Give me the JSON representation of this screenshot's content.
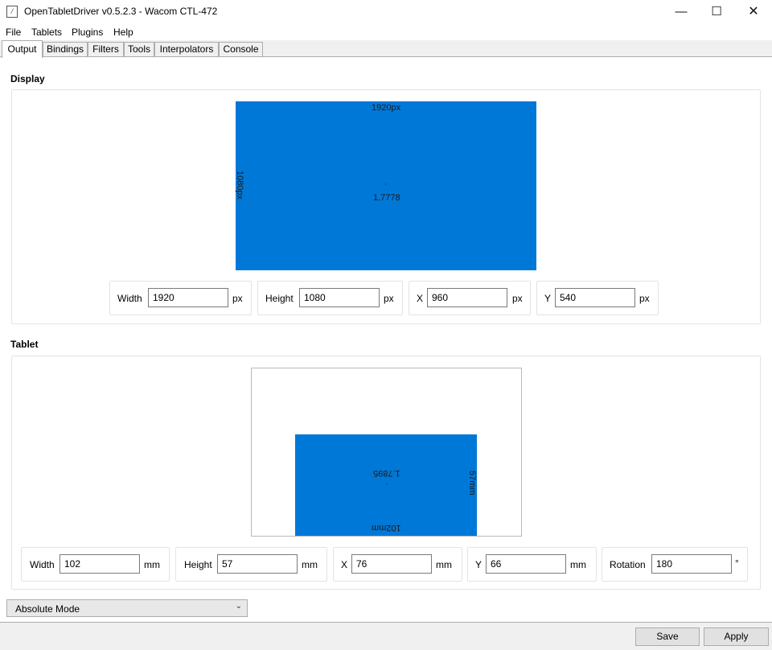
{
  "window": {
    "title": "OpenTabletDriver v0.5.2.3 - Wacom CTL-472",
    "app_icon": "document-edit-icon",
    "minimize_glyph": "—",
    "maximize_glyph": "☐",
    "close_glyph": "✕"
  },
  "menu": [
    "File",
    "Tablets",
    "Plugins",
    "Help"
  ],
  "tabs": [
    "Output",
    "Bindings",
    "Filters",
    "Tools",
    "Interpolators",
    "Console"
  ],
  "active_tab": "Output",
  "display": {
    "section_label": "Display",
    "area": {
      "width_label": "1920px",
      "height_label": "1080px",
      "center_dot": "·",
      "ratio": "1.7778"
    },
    "width": {
      "label": "Width",
      "value": "1920",
      "unit": "px"
    },
    "height": {
      "label": "Height",
      "value": "1080",
      "unit": "px"
    },
    "x": {
      "label": "X",
      "value": "960",
      "unit": "px"
    },
    "y": {
      "label": "Y",
      "value": "540",
      "unit": "px"
    }
  },
  "tablet": {
    "section_label": "Tablet",
    "area": {
      "width_label": "102mm",
      "height_label": "57mm",
      "center_dot": "·",
      "ratio": "1.7895"
    },
    "width": {
      "label": "Width",
      "value": "102",
      "unit": "mm"
    },
    "height": {
      "label": "Height",
      "value": "57",
      "unit": "mm"
    },
    "x": {
      "label": "X",
      "value": "76",
      "unit": "mm"
    },
    "y": {
      "label": "Y",
      "value": "66",
      "unit": "mm"
    },
    "rotation": {
      "label": "Rotation",
      "value": "180",
      "unit": "°"
    }
  },
  "mode": {
    "selected": "Absolute Mode",
    "chevron": "⌄"
  },
  "buttons": {
    "save": "Save",
    "apply": "Apply"
  },
  "colors": {
    "area_fill": "#0078d7",
    "panel_bg": "#ffffff",
    "window_bg": "#f0f0f0"
  }
}
